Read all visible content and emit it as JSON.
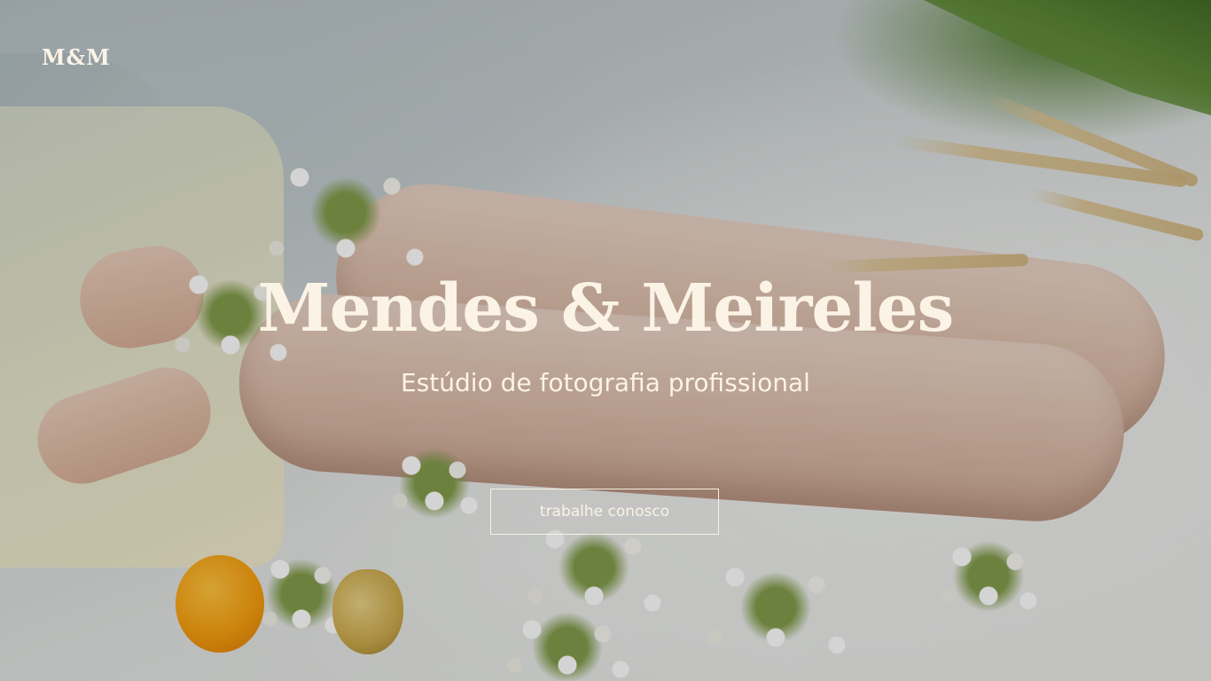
{
  "brand": {
    "logo_text": "M&M"
  },
  "hero": {
    "title": "Mendes & Meireles",
    "subtitle": "Estúdio de fotografia profissional",
    "cta_label": "trabalhe conosco"
  },
  "colors": {
    "text": "#fbf3e6",
    "overlay": "rgba(20,18,16,0.18)"
  }
}
